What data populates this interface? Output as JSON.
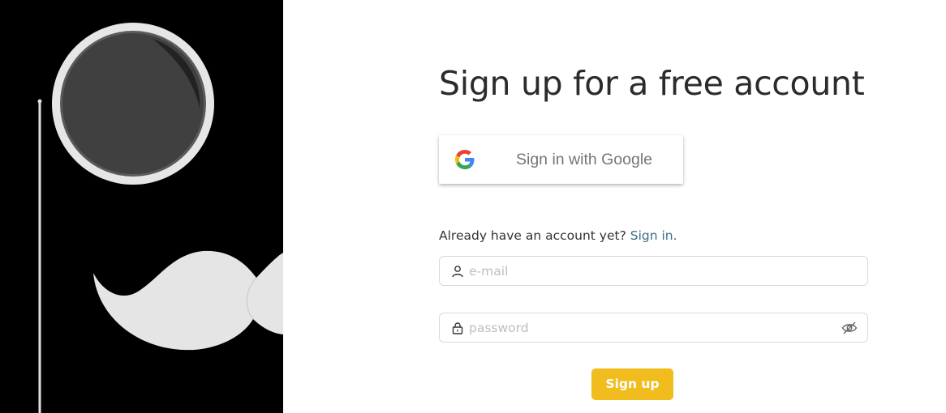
{
  "illustration": {
    "name": "monocle-and-mustache",
    "background": "#000000",
    "lens_color": "#404040",
    "rim_color": "#e6e6e6",
    "mustache_color": "#e5e5e5"
  },
  "form": {
    "title": "Sign up for a free account",
    "google_button": {
      "label": "Sign in with Google",
      "icon": "google-g-icon"
    },
    "signin_prompt": "Already have an account yet?",
    "signin_link": "Sign in.",
    "email": {
      "placeholder": "e-mail",
      "value": "",
      "icon": "user-icon"
    },
    "password": {
      "placeholder": "password",
      "value": "",
      "icon": "lock-icon",
      "toggle_icon": "eye-off-icon"
    },
    "submit_label": "Sign up"
  },
  "colors": {
    "accent": "#f0bc1e",
    "link": "#3f6e8c",
    "title": "#2b2b2b",
    "border": "#d9d9d9"
  }
}
